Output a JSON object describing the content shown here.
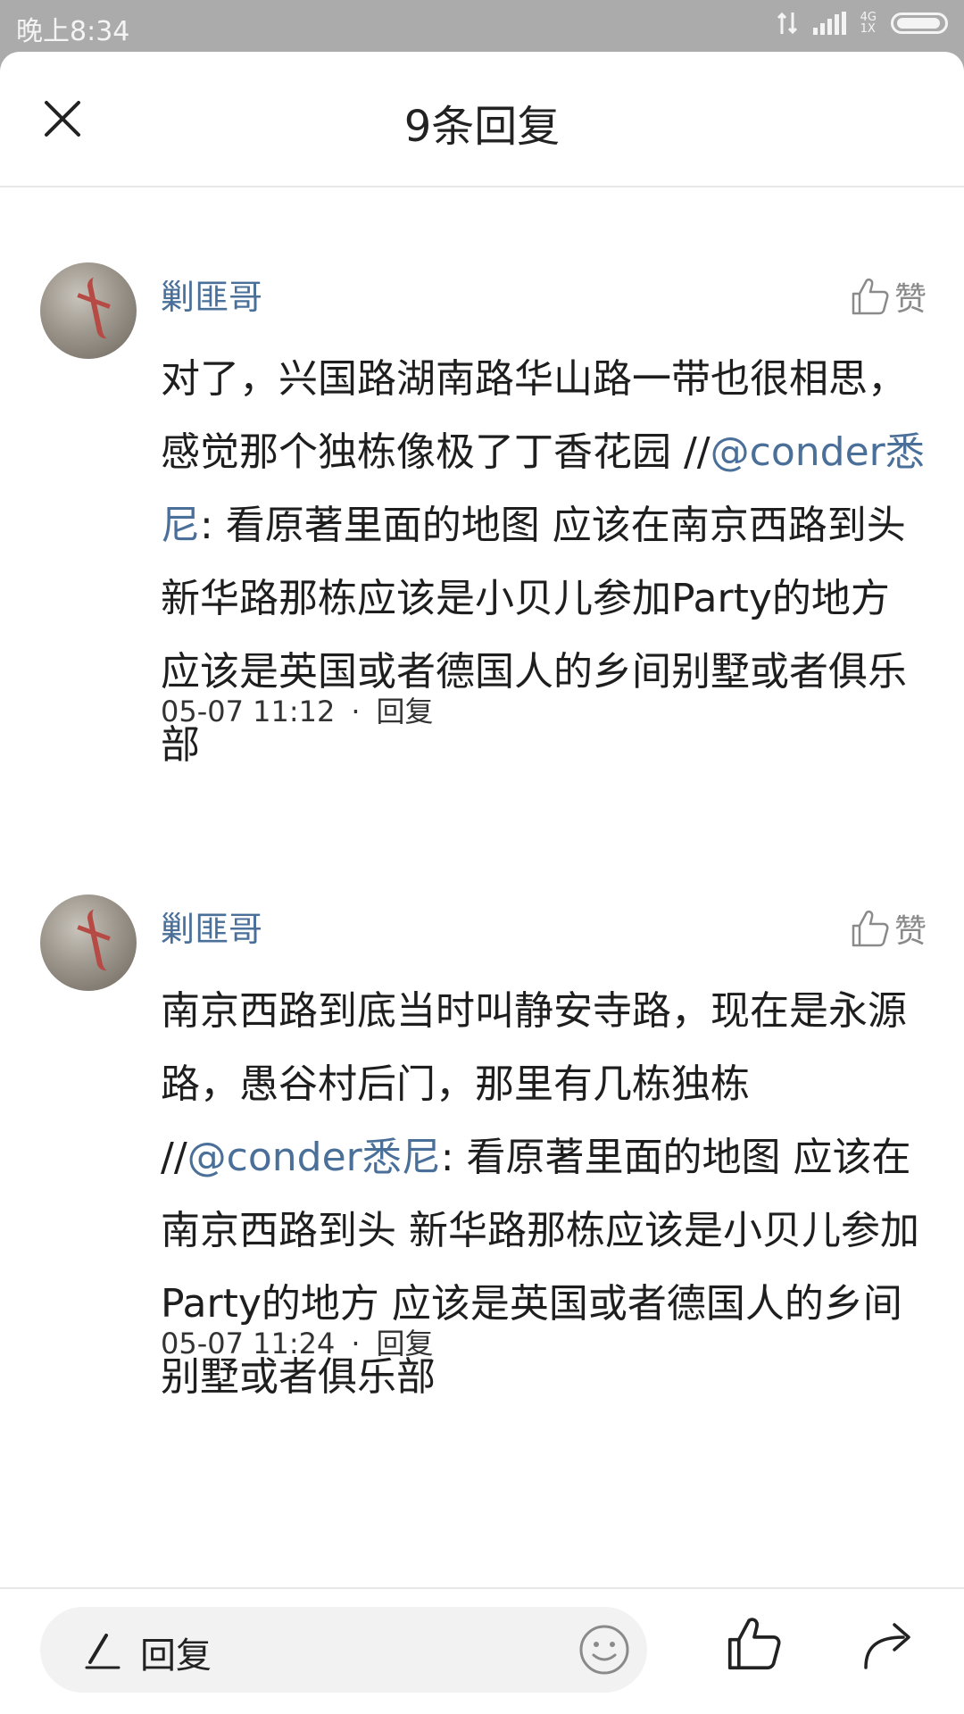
{
  "status_bar": {
    "time": "晚上8:34",
    "network": "4G",
    "network_sub": "1X"
  },
  "header": {
    "title": "9条回复"
  },
  "comments": [
    {
      "username": "剿匪哥",
      "like_label": "赞",
      "text_before": "对了，兴国路湖南路华山路一带也很相思，感觉那个独栋像极了丁香花园 //",
      "mention": "@conder悉尼",
      "text_after": ": 看原著里面的地图 应该在南京西路到头 新华路那栋应该是小贝儿参加Party的地方 应该是英国或者德国人的乡间别墅或者俱乐部",
      "time": "05-07 11:12",
      "reply_label": "回复"
    },
    {
      "username": "剿匪哥",
      "like_label": "赞",
      "text_before": "南京西路到底当时叫静安寺路，现在是永源路，愚谷村后门，那里有几栋独栋 //",
      "mention": "@conder悉尼",
      "text_after": ": 看原著里面的地图 应该在南京西路到头 新华路那栋应该是小贝儿参加Party的地方 应该是英国或者德国人的乡间别墅或者俱乐部",
      "time": "05-07 11:24",
      "reply_label": "回复"
    }
  ],
  "bottom_bar": {
    "reply_placeholder": "回复"
  }
}
